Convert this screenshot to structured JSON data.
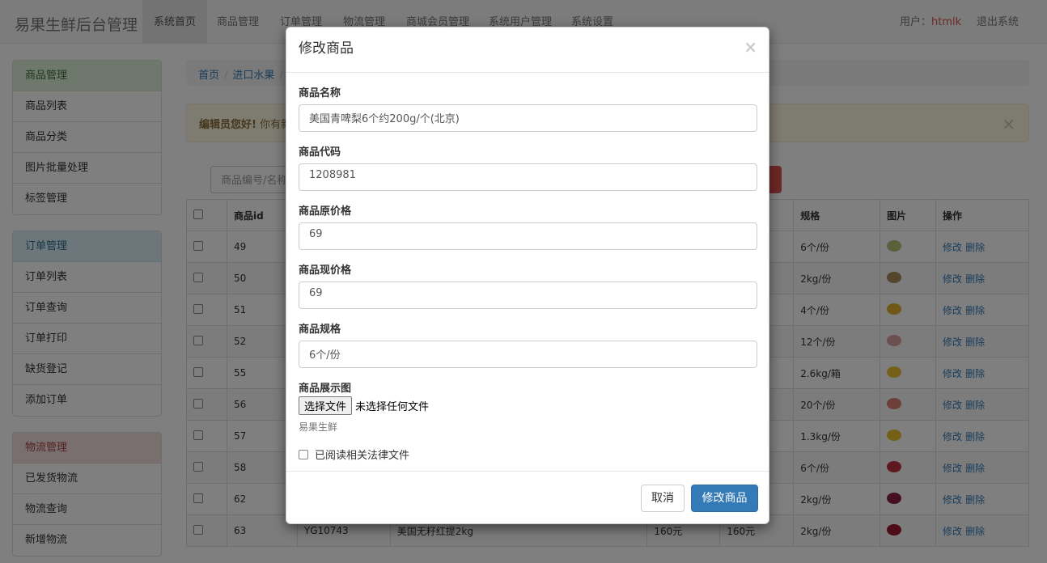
{
  "navbar": {
    "brand": "易果生鲜后台管理",
    "items": [
      "系统首页",
      "商品管理",
      "订单管理",
      "物流管理",
      "商城会员管理",
      "系统用户管理",
      "系统设置"
    ],
    "user_label": "用户：",
    "user_name": "htmlk",
    "logout": "退出系统"
  },
  "sidebar": {
    "product": {
      "title": "商品管理",
      "items": [
        "商品列表",
        "商品分类",
        "图片批量处理",
        "标签管理"
      ]
    },
    "order": {
      "title": "订单管理",
      "items": [
        "订单列表",
        "订单查询",
        "订单打印",
        "缺货登记",
        "添加订单"
      ]
    },
    "logistics": {
      "title": "物流管理",
      "items": [
        "已发货物流",
        "物流查询",
        "新增物流"
      ]
    }
  },
  "breadcrumb": [
    "首页",
    "进口水果"
  ],
  "alert": {
    "bold": "编辑员您好!",
    "text": "你有新的"
  },
  "search": {
    "placeholder": "商品编号/名称"
  },
  "table": {
    "headers": [
      "",
      "商品id",
      "",
      "",
      "",
      "",
      "规格",
      "图片",
      "操作"
    ],
    "last_row": {
      "code": "YG10743",
      "name": "美国无籽红提2kg",
      "orig": "160元",
      "now": "160元"
    },
    "rows": [
      {
        "id": "49",
        "spec": "6个/份",
        "fruit": "#b5c27a"
      },
      {
        "id": "50",
        "spec": "2kg/份",
        "fruit": "#a88a5a"
      },
      {
        "id": "51",
        "spec": "4个/份",
        "fruit": "#e0b030"
      },
      {
        "id": "52",
        "spec": "12个/份",
        "fruit": "#d9a0a0"
      },
      {
        "id": "55",
        "spec": "2.6kg/箱",
        "fruit": "#e8c030"
      },
      {
        "id": "56",
        "spec": "20个/份",
        "fruit": "#d88070"
      },
      {
        "id": "57",
        "spec": "1.3kg/份",
        "fruit": "#e8c030"
      },
      {
        "id": "58",
        "spec": "6个/份",
        "fruit": "#c03040"
      },
      {
        "id": "62",
        "spec": "2kg/份",
        "fruit": "#8a2040"
      },
      {
        "id": "63",
        "spec": "2kg/份",
        "fruit": "#9a1830"
      }
    ],
    "ops": {
      "edit": "修改",
      "delete": "删除"
    }
  },
  "modal": {
    "title": "修改商品",
    "close": "×",
    "fields": {
      "name_label": "商品名称",
      "name_value": "美国青啤梨6个约200g/个(北京)",
      "code_label": "商品代码",
      "code_value": "1208981",
      "orig_label": "商品原价格",
      "orig_value": "69",
      "now_label": "商品现价格",
      "now_value": "69",
      "spec_label": "商品规格",
      "spec_value": "6个/份",
      "image_label": "商品展示图",
      "file_button": "选择文件",
      "file_status": "未选择任何文件",
      "help": "易果生鲜",
      "agree": "已阅读相关法律文件"
    },
    "cancel": "取消",
    "submit": "修改商品"
  }
}
